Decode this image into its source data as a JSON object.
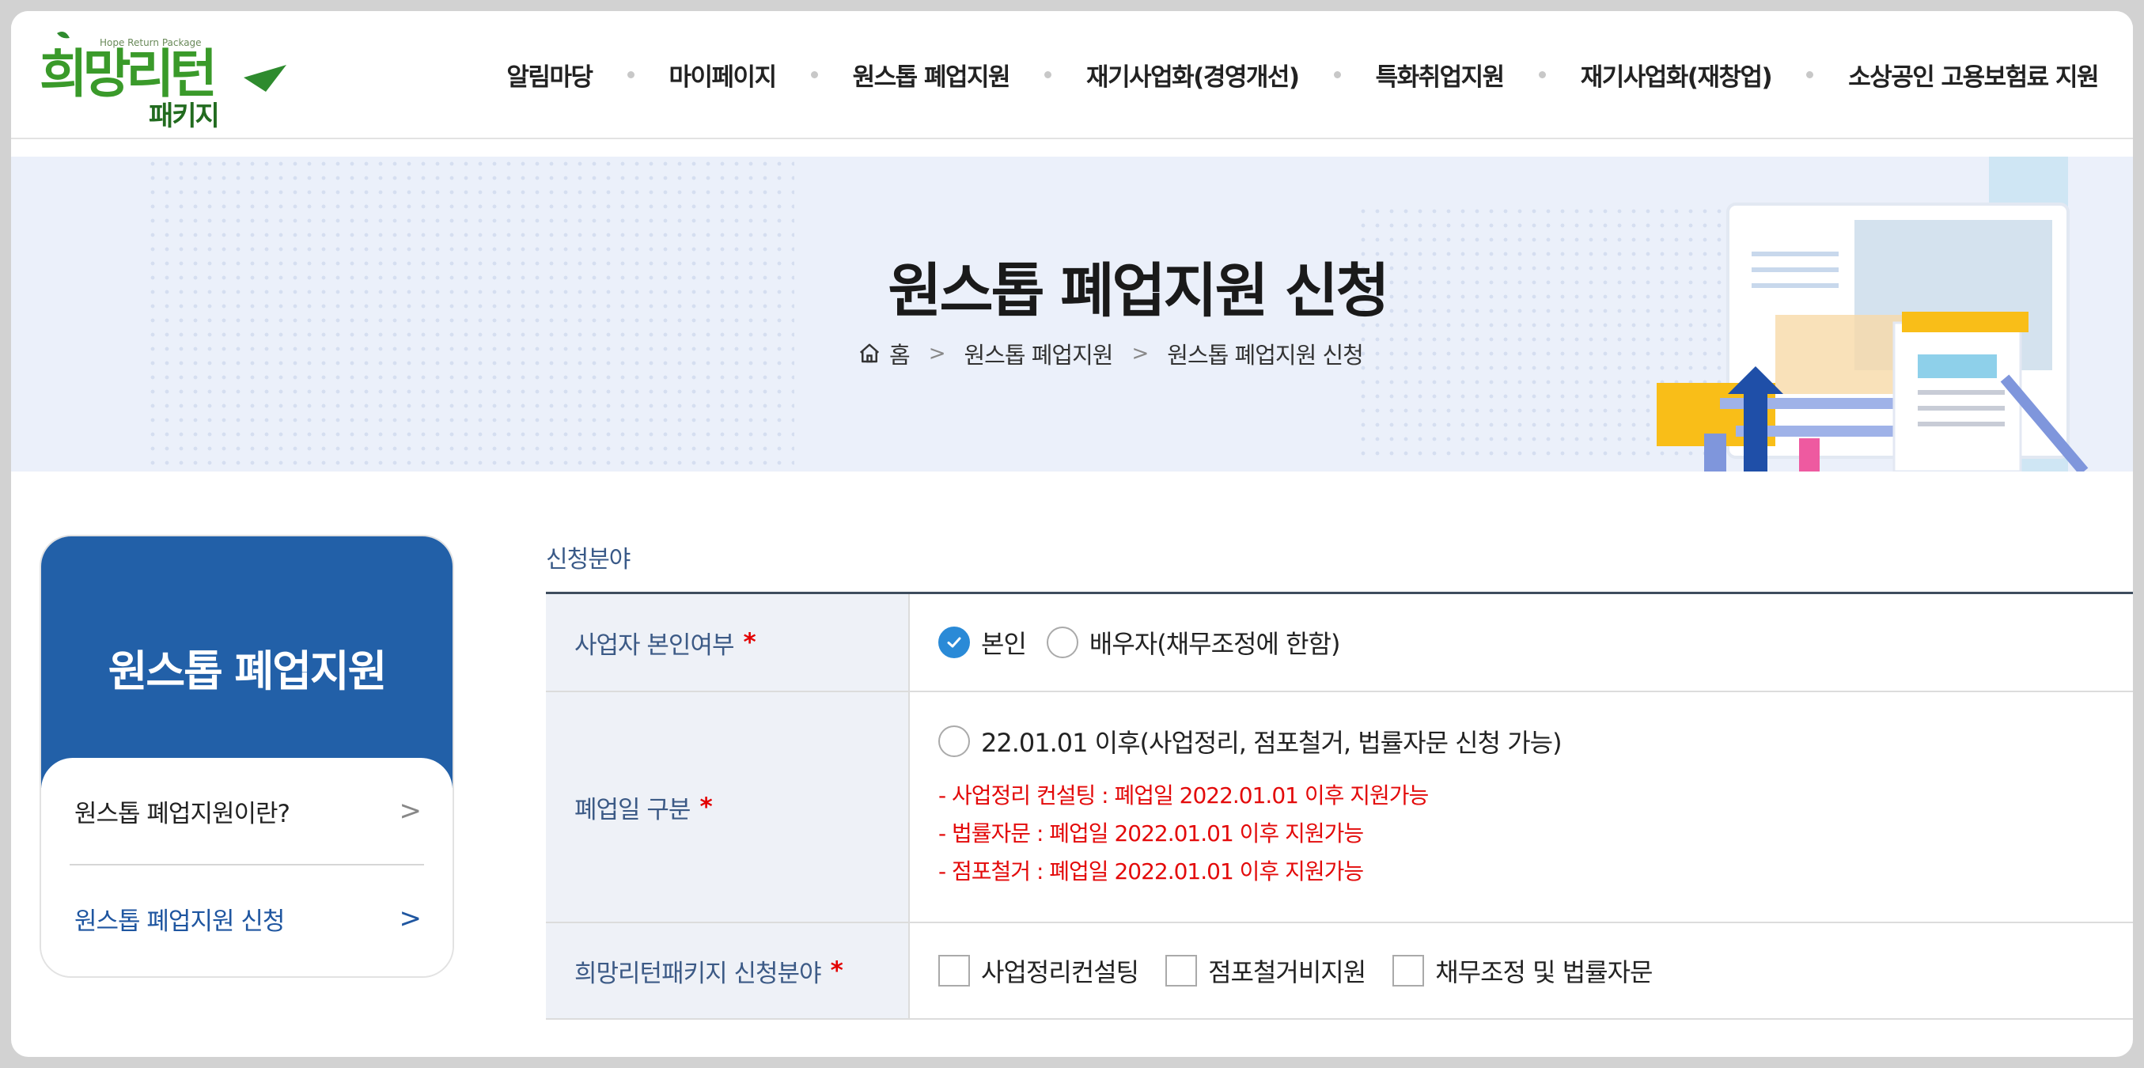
{
  "header": {
    "logo_text": "희망리턴",
    "logo_sub": "패키지",
    "logo_eng": "Hope Return Package",
    "nav": [
      "알림마당",
      "마이페이지",
      "원스톱 폐업지원",
      "재기사업화(경영개선)",
      "특화취업지원",
      "재기사업화(재창업)",
      "소상공인 고용보험료 지원"
    ]
  },
  "banner": {
    "title": "원스톱 폐업지원 신청",
    "breadcrumb": [
      "홈",
      "원스톱 폐업지원",
      "원스톱 폐업지원 신청"
    ]
  },
  "sidebar": {
    "title": "원스톱 폐업지원",
    "items": [
      {
        "label": "원스톱 폐업지원이란?",
        "active": false
      },
      {
        "label": "원스톱 폐업지원 신청",
        "active": true
      }
    ]
  },
  "form": {
    "section_title": "신청분야",
    "rows": [
      {
        "label": "사업자 본인여부",
        "required_mark": "*",
        "options": [
          {
            "label": "본인",
            "checked": true
          },
          {
            "label": "배우자(채무조정에 한함)",
            "checked": false
          }
        ]
      },
      {
        "label": "폐업일 구분",
        "required_mark": "*",
        "options": [
          {
            "label": "22.01.01 이후(사업정리, 점포철거, 법률자문 신청 가능)",
            "checked": false
          }
        ],
        "notes": [
          "- 사업정리 컨설팅 : 폐업일 2022.01.01 이후 지원가능",
          "- 법률자문 : 폐업일 2022.01.01 이후 지원가능",
          "- 점포철거 : 폐업일 2022.01.01 이후 지원가능"
        ]
      },
      {
        "label": "희망리턴패키지 신청분야",
        "required_mark": "*",
        "options": [
          {
            "label": "사업정리컨설팅",
            "checked": false
          },
          {
            "label": "점포철거비지원",
            "checked": false
          },
          {
            "label": "채무조정 및 법률자문",
            "checked": false
          }
        ]
      }
    ]
  },
  "colors": {
    "brand_blue": "#2260a8",
    "logo_green": "#2e8b2e",
    "required_red": "#e30000",
    "radio_checked": "#2a8ad7"
  }
}
